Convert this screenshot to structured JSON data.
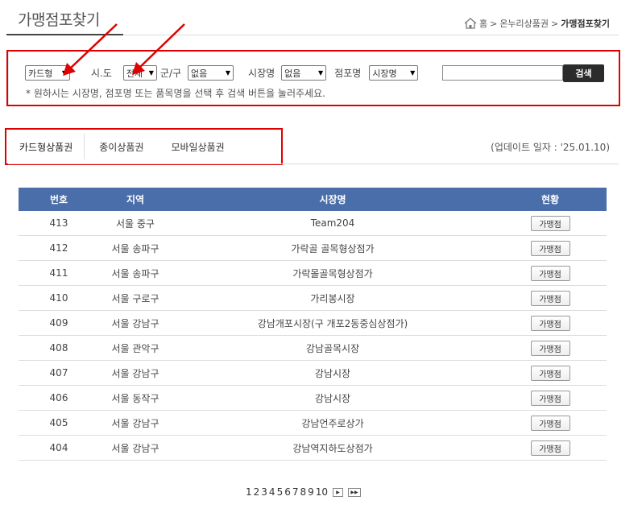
{
  "page": {
    "title": "가맹점포찾기"
  },
  "breadcrumb": {
    "home": "홈",
    "sep1": ">",
    "section": "온누리상품권",
    "sep2": ">",
    "current": "가맹점포찾기"
  },
  "search": {
    "type_value": "카드형",
    "sido_label": "시.도",
    "sido_value": "전체",
    "gungu_label": "군/구",
    "gungu_value": "없음",
    "market_label": "시장명",
    "market_value": "없음",
    "store_label": "점포명",
    "store_value": "시장명",
    "input_value": "",
    "button_label": "검색",
    "help": "* 원하시는 시장명, 점포명 또는 품목명을 선택 후 검색 버튼을 눌러주세요."
  },
  "tabs": [
    {
      "label": "카드형상품권"
    },
    {
      "label": "종이상품권"
    },
    {
      "label": "모바일상품권"
    }
  ],
  "update": "(업데이트 일자 : '25.01.10)",
  "table": {
    "headers": {
      "no": "번호",
      "region": "지역",
      "market": "시장명",
      "status": "현황"
    },
    "rows": [
      {
        "no": "413",
        "region": "서울 중구",
        "market": "Team204",
        "status": "가맹점"
      },
      {
        "no": "412",
        "region": "서울 송파구",
        "market": "가락골 골목형상점가",
        "status": "가맹점"
      },
      {
        "no": "411",
        "region": "서울 송파구",
        "market": "가락몰골목형상점가",
        "status": "가맹점"
      },
      {
        "no": "410",
        "region": "서울 구로구",
        "market": "가리봉시장",
        "status": "가맹점"
      },
      {
        "no": "409",
        "region": "서울 강남구",
        "market": "강남개포시장(구 개포2동중심상점가)",
        "status": "가맹점"
      },
      {
        "no": "408",
        "region": "서울 관악구",
        "market": "강남골목시장",
        "status": "가맹점"
      },
      {
        "no": "407",
        "region": "서울 강남구",
        "market": "강남시장",
        "status": "가맹점"
      },
      {
        "no": "406",
        "region": "서울 동작구",
        "market": "강남시장",
        "status": "가맹점"
      },
      {
        "no": "405",
        "region": "서울 강남구",
        "market": "강남언주로상가",
        "status": "가맹점"
      },
      {
        "no": "404",
        "region": "서울 강남구",
        "market": "강남역지하도상점가",
        "status": "가맹점"
      }
    ]
  },
  "pagination": {
    "pages": [
      "1",
      "2",
      "3",
      "4",
      "5",
      "6",
      "7",
      "8",
      "9",
      "10"
    ],
    "next": "▶",
    "last": "▶▶"
  },
  "colors": {
    "header_bg": "#4a6ea9",
    "highlight": "#e00000",
    "button_dark": "#2b2b2b"
  }
}
